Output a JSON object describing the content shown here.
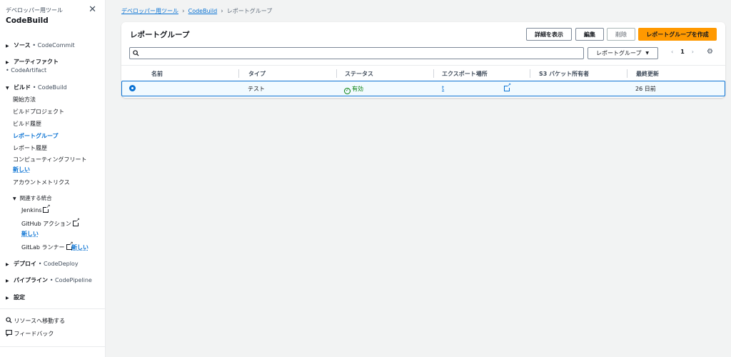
{
  "sidebar": {
    "subtitle": "デベロッパー用ツール",
    "title": "CodeBuild",
    "source": {
      "label": "ソース",
      "service": "• CodeCommit"
    },
    "artifact": {
      "label": "アーティファクト",
      "service": "• CodeArtifact"
    },
    "build": {
      "label": "ビルド",
      "service": "• CodeBuild"
    },
    "build_items": [
      "開始方法",
      "ビルドプロジェクト",
      "ビルド履歴",
      "レポートグループ",
      "レポート履歴",
      "コンピューティングフリート",
      "アカウントメトリクス"
    ],
    "new_label": "新しい",
    "related": {
      "label": "関連する統合",
      "jenkins": "Jenkins",
      "github": "GitHub アクション",
      "gitlab": "GitLab ランナー"
    },
    "deploy": {
      "label": "デプロイ",
      "service": "• CodeDeploy"
    },
    "pipeline": {
      "label": "パイプライン",
      "service": "• CodePipeline"
    },
    "settings": "設定",
    "goto_resource": "リソースへ移動する",
    "feedback": "フィードバック"
  },
  "breadcrumb": {
    "root": "デベロッパー用ツール",
    "service": "CodeBuild",
    "current": "レポートグループ"
  },
  "panel": {
    "title": "レポートグループ",
    "buttons": {
      "details": "詳細を表示",
      "edit": "編集",
      "delete": "削除",
      "create": "レポートグループを作成"
    },
    "filter_select": "レポートグループ",
    "page": "1"
  },
  "table": {
    "headers": [
      "名前",
      "タイプ",
      "ステータス",
      "エクスポート場所",
      "S3 バケット所有者",
      "最終更新"
    ],
    "rows": [
      {
        "name": "",
        "type": "テスト",
        "status": "有効",
        "export": "t",
        "owner": "",
        "updated": "26 日前"
      }
    ]
  },
  "colors": {
    "accent": "#0972d3",
    "primary_button": "#ff9900",
    "success": "#037f0c"
  }
}
